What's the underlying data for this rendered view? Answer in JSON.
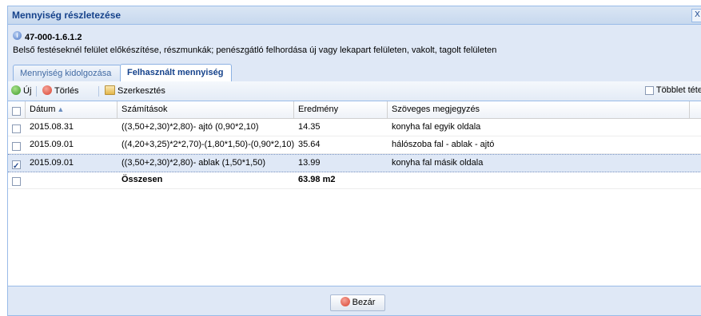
{
  "window": {
    "title": "Mennyiség részletezése",
    "close_glyph": "X"
  },
  "info": {
    "code": "47-000-1.6.1.2",
    "description": "Belső festéseknél felület előkészítése, részmunkák; penészgátló felhordása új vagy lekapart felületen, vakolt, tagolt felületen"
  },
  "tabs": [
    {
      "label": "Mennyiség kidolgozása",
      "active": false
    },
    {
      "label": "Felhasznált mennyiség",
      "active": true
    }
  ],
  "toolbar": {
    "add_label": "Új",
    "delete_label": "Törlés",
    "edit_label": "Szerkesztés",
    "extra_label": "Többlet tétel"
  },
  "table": {
    "columns": [
      "Dátum",
      "Számítások",
      "Eredmény",
      "Szöveges megjegyzés"
    ],
    "sort_indicator": "▲",
    "rows": [
      {
        "date": "2015.08.31",
        "calc": "((3,50+2,30)*2,80)- ajtó (0,90*2,10)",
        "result": "14.35",
        "note": "konyha fal egyik oldala",
        "checked": false
      },
      {
        "date": "2015.09.01",
        "calc": "((4,20+3,25)*2*2,70)-(1,80*1,50)-(0,90*2,10)",
        "result": "35.64",
        "note": "hálószoba fal - ablak - ajtó",
        "checked": false
      },
      {
        "date": "2015.09.01",
        "calc": "((3,50+2,30)*2,80)- ablak (1,50*1,50)",
        "result": "13.99",
        "note": "konyha fal másik oldala",
        "checked": true
      }
    ],
    "total": {
      "label": "Összesen",
      "value": "63.98 m2"
    }
  },
  "footer": {
    "close_label": "Bezár"
  },
  "colors": {
    "accent": "#15428b",
    "frame": "#99bbe8",
    "background": "#dfe8f6"
  }
}
